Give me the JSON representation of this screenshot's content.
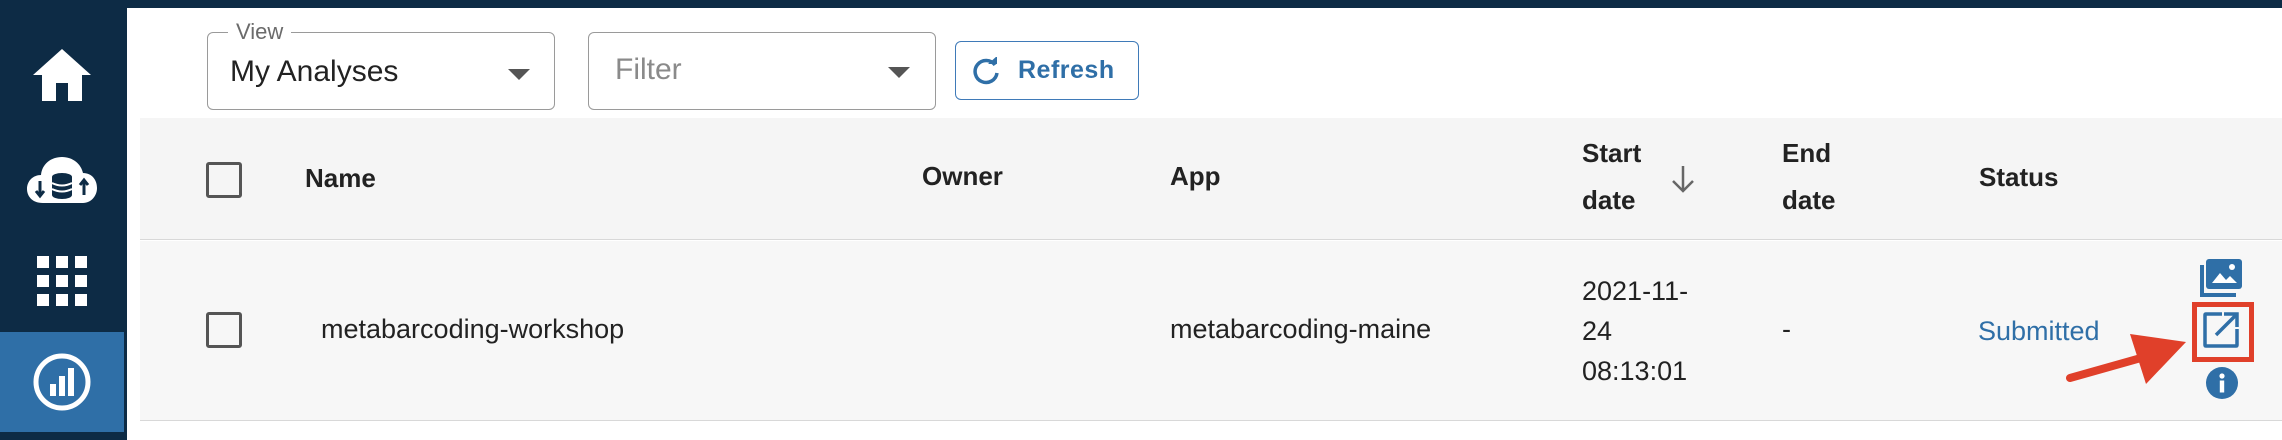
{
  "sidebar": {
    "items": [
      {
        "icon": "home-icon"
      },
      {
        "icon": "cloud-data-icon"
      },
      {
        "icon": "apps-grid-icon"
      },
      {
        "icon": "analyses-icon",
        "active": true
      }
    ]
  },
  "toolbar": {
    "view_label": "View",
    "view_value": "My Analyses",
    "filter_placeholder": "Filter",
    "refresh_label": "Refresh"
  },
  "table": {
    "headers": {
      "name": "Name",
      "owner": "Owner",
      "app": "App",
      "start_line1": "Start",
      "start_line2": "date",
      "end_line1": "End",
      "end_line2": "date",
      "status": "Status"
    },
    "rows": [
      {
        "name": "metabarcoding-workshop",
        "owner": "",
        "app": "metabarcoding-maine",
        "start_line1": "2021-11-",
        "start_line2": "24",
        "start_line3": "08:13:01",
        "end": "-",
        "status": "Submitted"
      }
    ]
  },
  "colors": {
    "sidebar": "#0d2b45",
    "active": "#2f6fa7",
    "link": "#2f6fa7",
    "highlight": "#e0402a"
  }
}
